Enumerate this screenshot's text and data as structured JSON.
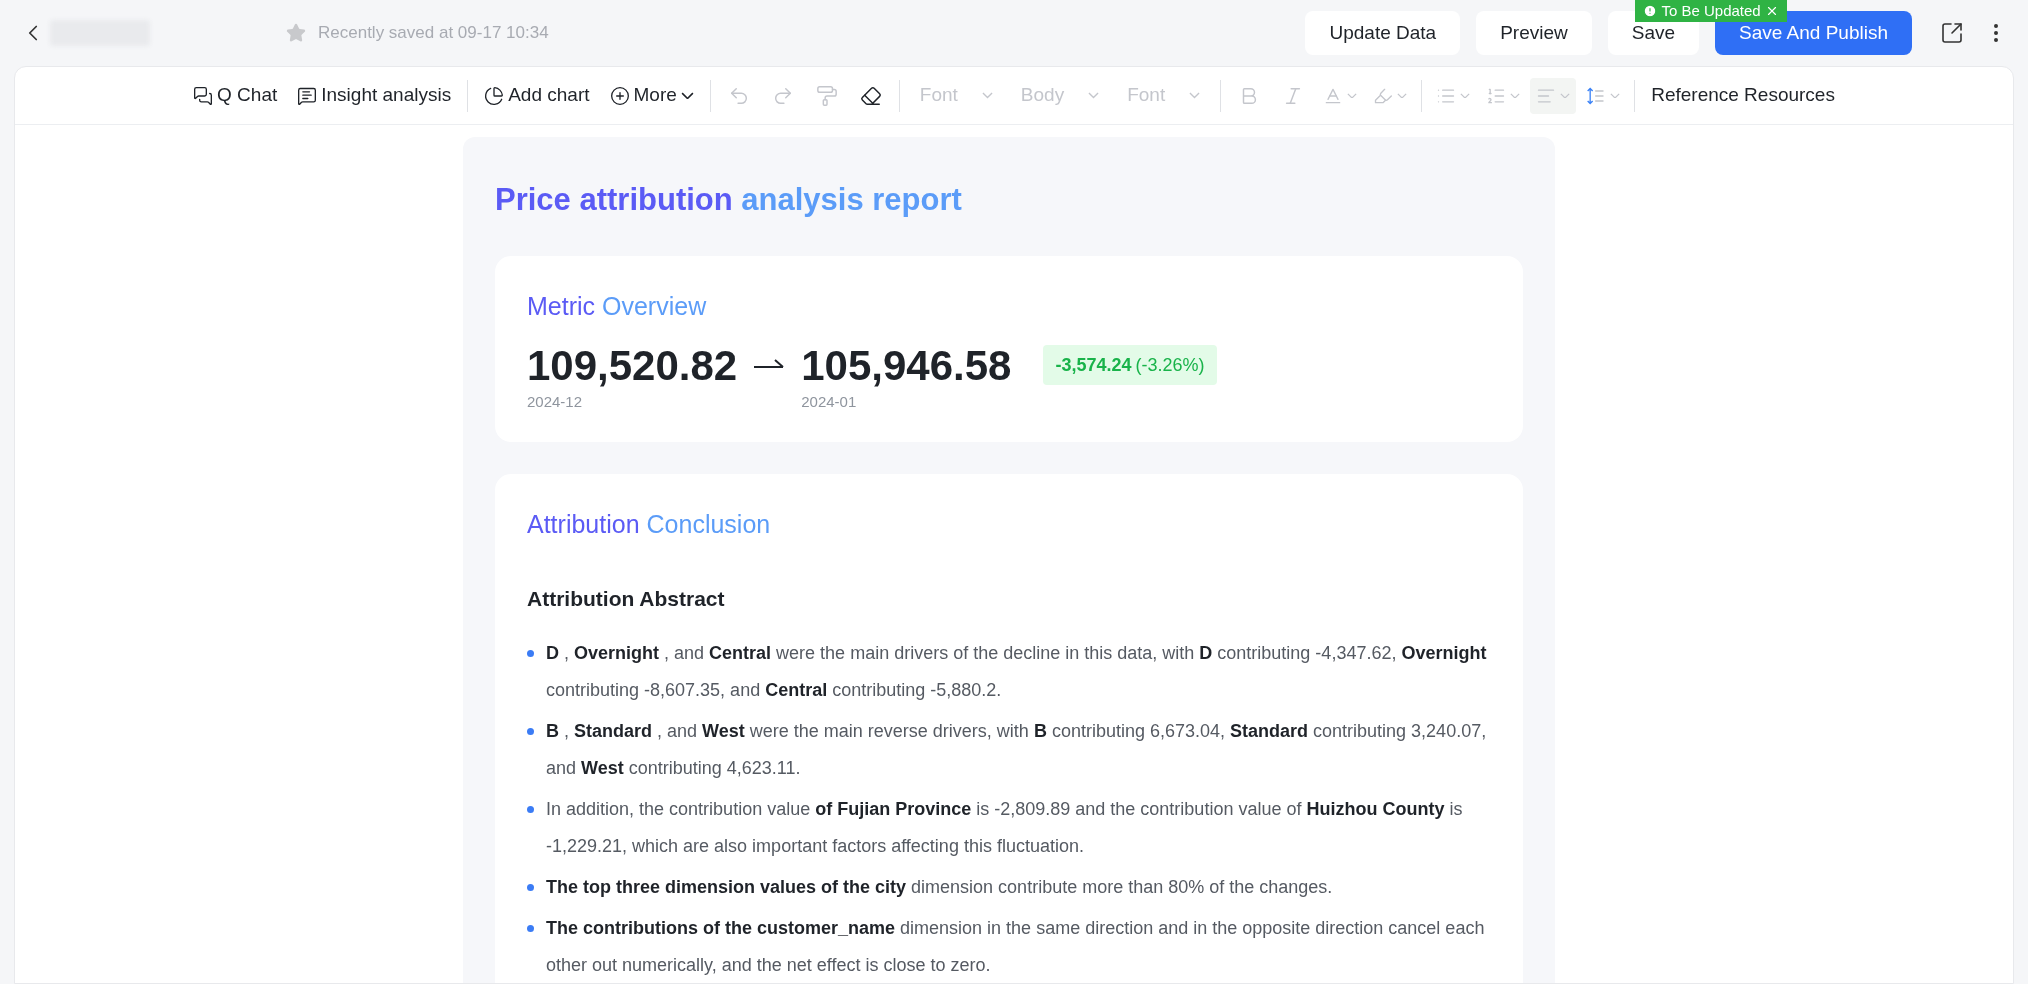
{
  "header": {
    "saved_text": "Recently saved at 09-17 10:34",
    "buttons": [
      {
        "kind": "plain",
        "label": "Update Data"
      },
      {
        "kind": "plain",
        "label": "Preview"
      },
      {
        "kind": "plain",
        "label": "Save"
      },
      {
        "kind": "primary",
        "label": "Save And Publish"
      }
    ],
    "badge": {
      "label": "To Be Updated"
    }
  },
  "toolbar": {
    "groups": [
      [
        {
          "kind": "button",
          "label": "Q Chat",
          "disabled": false
        },
        {
          "kind": "button",
          "label": "Insight analysis",
          "disabled": false
        }
      ],
      [
        {
          "kind": "button",
          "label": "Add chart",
          "disabled": false
        },
        {
          "kind": "menu",
          "label": "More",
          "disabled": false
        }
      ],
      [
        {
          "kind": "icon",
          "disabled": true
        },
        {
          "kind": "icon",
          "disabled": true
        },
        {
          "kind": "icon",
          "disabled": true
        },
        {
          "kind": "icon",
          "disabled": false
        }
      ],
      [
        {
          "kind": "select",
          "label": "Font",
          "disabled": true
        },
        {
          "kind": "select",
          "label": "Body",
          "disabled": true
        },
        {
          "kind": "select",
          "label": "Font",
          "disabled": true
        }
      ],
      [
        {
          "kind": "icon",
          "disabled": true
        },
        {
          "kind": "icon",
          "disabled": true
        },
        {
          "kind": "icon_menu",
          "disabled": true
        },
        {
          "kind": "icon_menu",
          "disabled": true
        }
      ],
      [
        {
          "kind": "icon_menu",
          "disabled": true,
          "active": false
        },
        {
          "kind": "icon_menu",
          "disabled": true,
          "active": false
        },
        {
          "kind": "icon_menu",
          "disabled": true,
          "active": true
        },
        {
          "kind": "icon_menu",
          "disabled": true,
          "active": false
        }
      ],
      [
        {
          "kind": "text",
          "label": "Reference Resources",
          "disabled": false
        }
      ]
    ]
  },
  "report": {
    "title_parts": [
      "Price attribution",
      "analysis report"
    ],
    "metric_overview": {
      "title_parts": [
        "Metric",
        "Overview"
      ],
      "from_value": "109,520.82",
      "from_period": "2024-12",
      "to_value": "105,946.58",
      "to_period": "2024-01",
      "change": "-3,574.24",
      "change_pct": "(-3.26%)"
    },
    "conclusion": {
      "title_parts": [
        "Attribution",
        "Conclusion"
      ],
      "abstract_title": "Attribution Abstract",
      "bullets": [
        "**D** , **Overnight** , and **Central** were the main drivers of the decline in this data, with **D** contributing -4,347.62, **Overnight** contributing -8,607.35, and **Central** contributing -5,880.2.",
        "**B** , **Standard** , and **West** were the main reverse drivers, with **B** contributing 6,673.04, **Standard** contributing 3,240.07, and **West** contributing 4,623.11.",
        "In addition, the contribution value **of Fujian Province** is -2,809.89 and the contribution value of **Huizhou County** is -1,229.21, which are also important factors affecting this fluctuation.",
        "**The top three dimension values of the city** dimension contribute more than 80% of the changes.",
        "**The contributions of the customer_name** dimension in the same direction and in the opposite direction cancel each other out numerically, and the net effect is close to zero."
      ]
    }
  }
}
